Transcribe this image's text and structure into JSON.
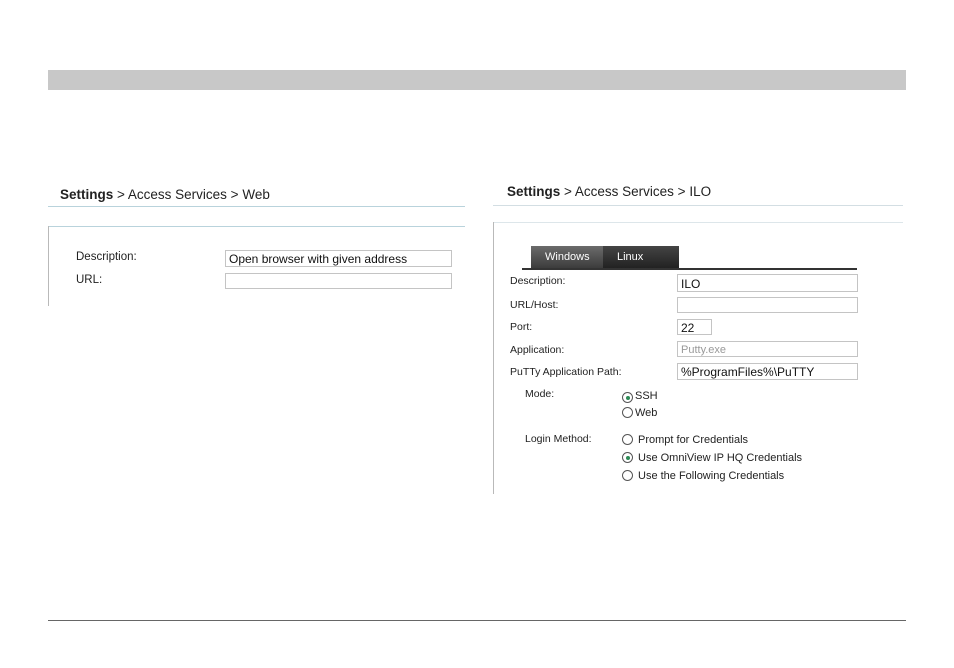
{
  "left_panel": {
    "breadcrumb": {
      "root": "Settings",
      "rest": " > Access Services > Web"
    },
    "fields": {
      "description_label": "Description:",
      "description_value": "Open browser with given address",
      "url_label": "URL:",
      "url_value": ""
    }
  },
  "right_panel": {
    "breadcrumb": {
      "root": "Settings",
      "rest": " > Access Services > ILO"
    },
    "tabs": [
      {
        "label": "Windows"
      },
      {
        "label": "Linux"
      }
    ],
    "fields": {
      "description_label": "Description:",
      "description_value": "ILO",
      "urlhost_label": "URL/Host:",
      "urlhost_value": "",
      "port_label": "Port:",
      "port_value": "22",
      "application_label": "Application:",
      "application_value": "Putty.exe",
      "putty_path_label": "PuTTy Application Path:",
      "putty_path_value": "%ProgramFiles%\\PuTTY"
    },
    "mode": {
      "label": "Mode:",
      "options": [
        {
          "label": "SSH",
          "selected": true
        },
        {
          "label": "Web",
          "selected": false
        }
      ]
    },
    "login": {
      "label": "Login Method:",
      "options": [
        {
          "label": "Prompt for Credentials",
          "selected": false
        },
        {
          "label": "Use OmniView IP HQ Credentials",
          "selected": true
        },
        {
          "label": "Use the Following Credentials",
          "selected": false
        }
      ]
    }
  },
  "colors": {
    "top_bar": "#c8c8c8",
    "tab_bg": "#3c3c3c",
    "radio_selected": "#2e8b57"
  }
}
